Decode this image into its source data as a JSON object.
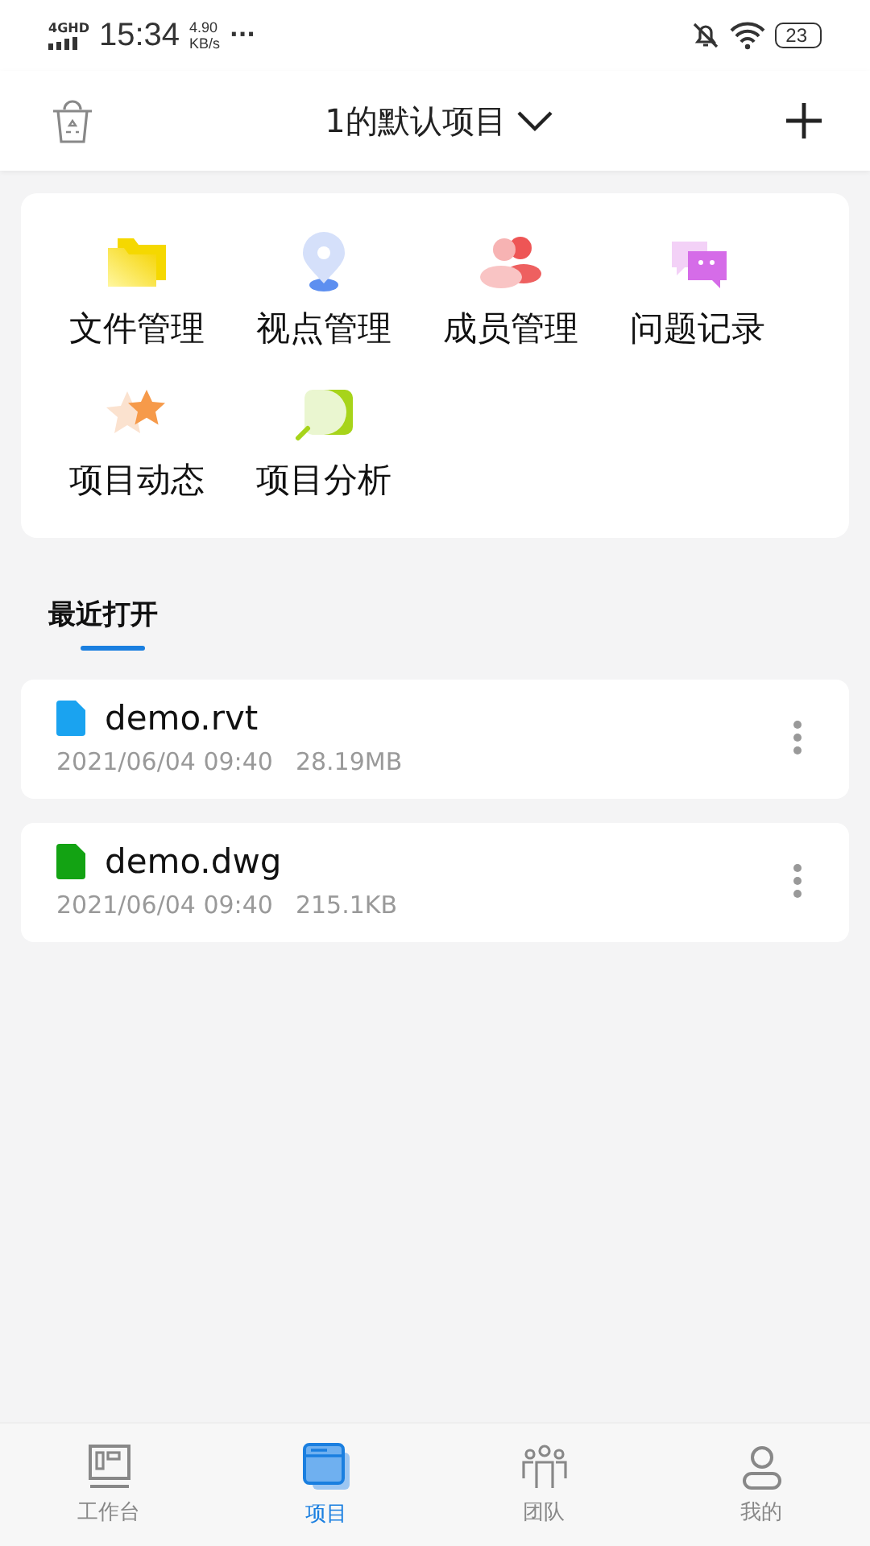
{
  "status_bar": {
    "network": "4GHD",
    "time": "15:34",
    "speed": "4.90",
    "speed_unit": "KB/s",
    "more": "···",
    "battery": "23"
  },
  "header": {
    "title": "1的默认项目"
  },
  "modules": [
    {
      "label": "文件管理",
      "kind": "folder"
    },
    {
      "label": "视点管理",
      "kind": "pin"
    },
    {
      "label": "成员管理",
      "kind": "members"
    },
    {
      "label": "问题记录",
      "kind": "chat"
    },
    {
      "label": "项目动态",
      "kind": "star"
    },
    {
      "label": "项目分析",
      "kind": "analysis"
    }
  ],
  "recent": {
    "title": "最近打开",
    "files": [
      {
        "name": "demo.rvt",
        "date": "2021/06/04 09:40",
        "size": "28.19MB",
        "color": "#1aa3f0"
      },
      {
        "name": "demo.dwg",
        "date": "2021/06/04 09:40",
        "size": "215.1KB",
        "color": "#13a313"
      }
    ]
  },
  "tabs": [
    {
      "label": "工作台",
      "kind": "board",
      "selected": false
    },
    {
      "label": "项目",
      "kind": "project",
      "selected": true
    },
    {
      "label": "团队",
      "kind": "team",
      "selected": false
    },
    {
      "label": "我的",
      "kind": "me",
      "selected": false
    }
  ]
}
